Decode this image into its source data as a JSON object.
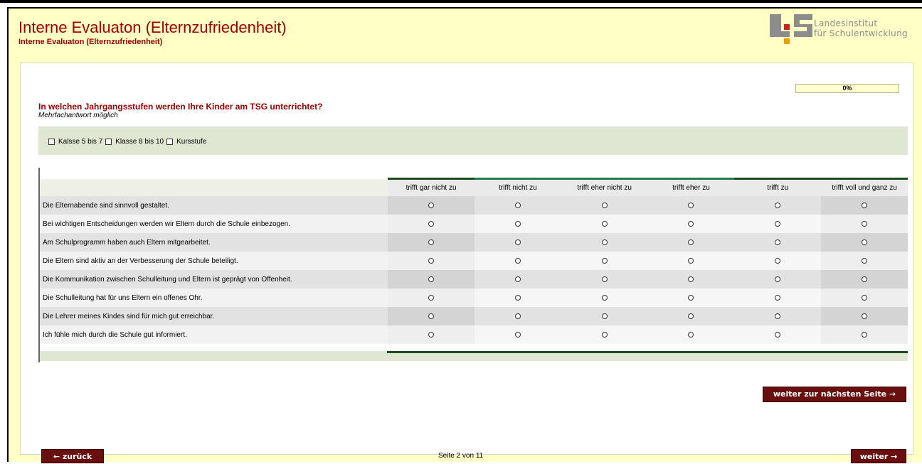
{
  "header": {
    "title": "Interne Evaluaton (Elternzufriedenheit)",
    "subtitle": "Interne Evaluaton (Elternzufriedenheit)",
    "logo_text_line1": "Landesinstitut",
    "logo_text_line2": "für Schulentwicklung",
    "logo_letters": "LS"
  },
  "progress": {
    "label": "0%",
    "value": 0
  },
  "question1": {
    "text": "In welchen Jahrgangsstufen werden Ihre Kinder am TSG unterrichtet?",
    "hint": "Mehrfachantwort möglich",
    "options": [
      "Kalsse 5 bis 7",
      "Klasse 8 bis 10",
      "Kursstufe"
    ]
  },
  "matrix": {
    "columns": [
      "trifft gar nicht zu",
      "trifft nicht zu",
      "trifft eher nicht zu",
      "trifft eher zu",
      "trifft zu",
      "trifft voll und ganz zu"
    ],
    "rows": [
      "Die Elternabende sind sinnvoll gestaltet.",
      "Bei wichtigen Entscheidungen werden wir Eltern durch die Schule einbezogen.",
      "Am Schulprogramm haben auch Eltern mitgearbeitet.",
      "Die Eltern sind aktiv an der Verbesserung der Schule beteiligt.",
      "Die Kommunikation zwischen Schulleitung und Eltern ist geprägt von Offenheit.",
      "Die Schulleitung hat für uns Eltern ein offenes Ohr.",
      "Die Lehrer meines Kindes sind für mich gut erreichbar.",
      "Ich fühle mich durch die Schule gut informiert."
    ]
  },
  "nav": {
    "next_page": "weiter zur nächsten Seite →",
    "back": "← zurück",
    "forward": "weiter →",
    "page_indicator": "Seite 2 von 11"
  },
  "colors": {
    "accent": "#a00000",
    "background": "#ffffc6",
    "button": "#6a0f0f",
    "matrix_border": "#1a4d1a"
  }
}
